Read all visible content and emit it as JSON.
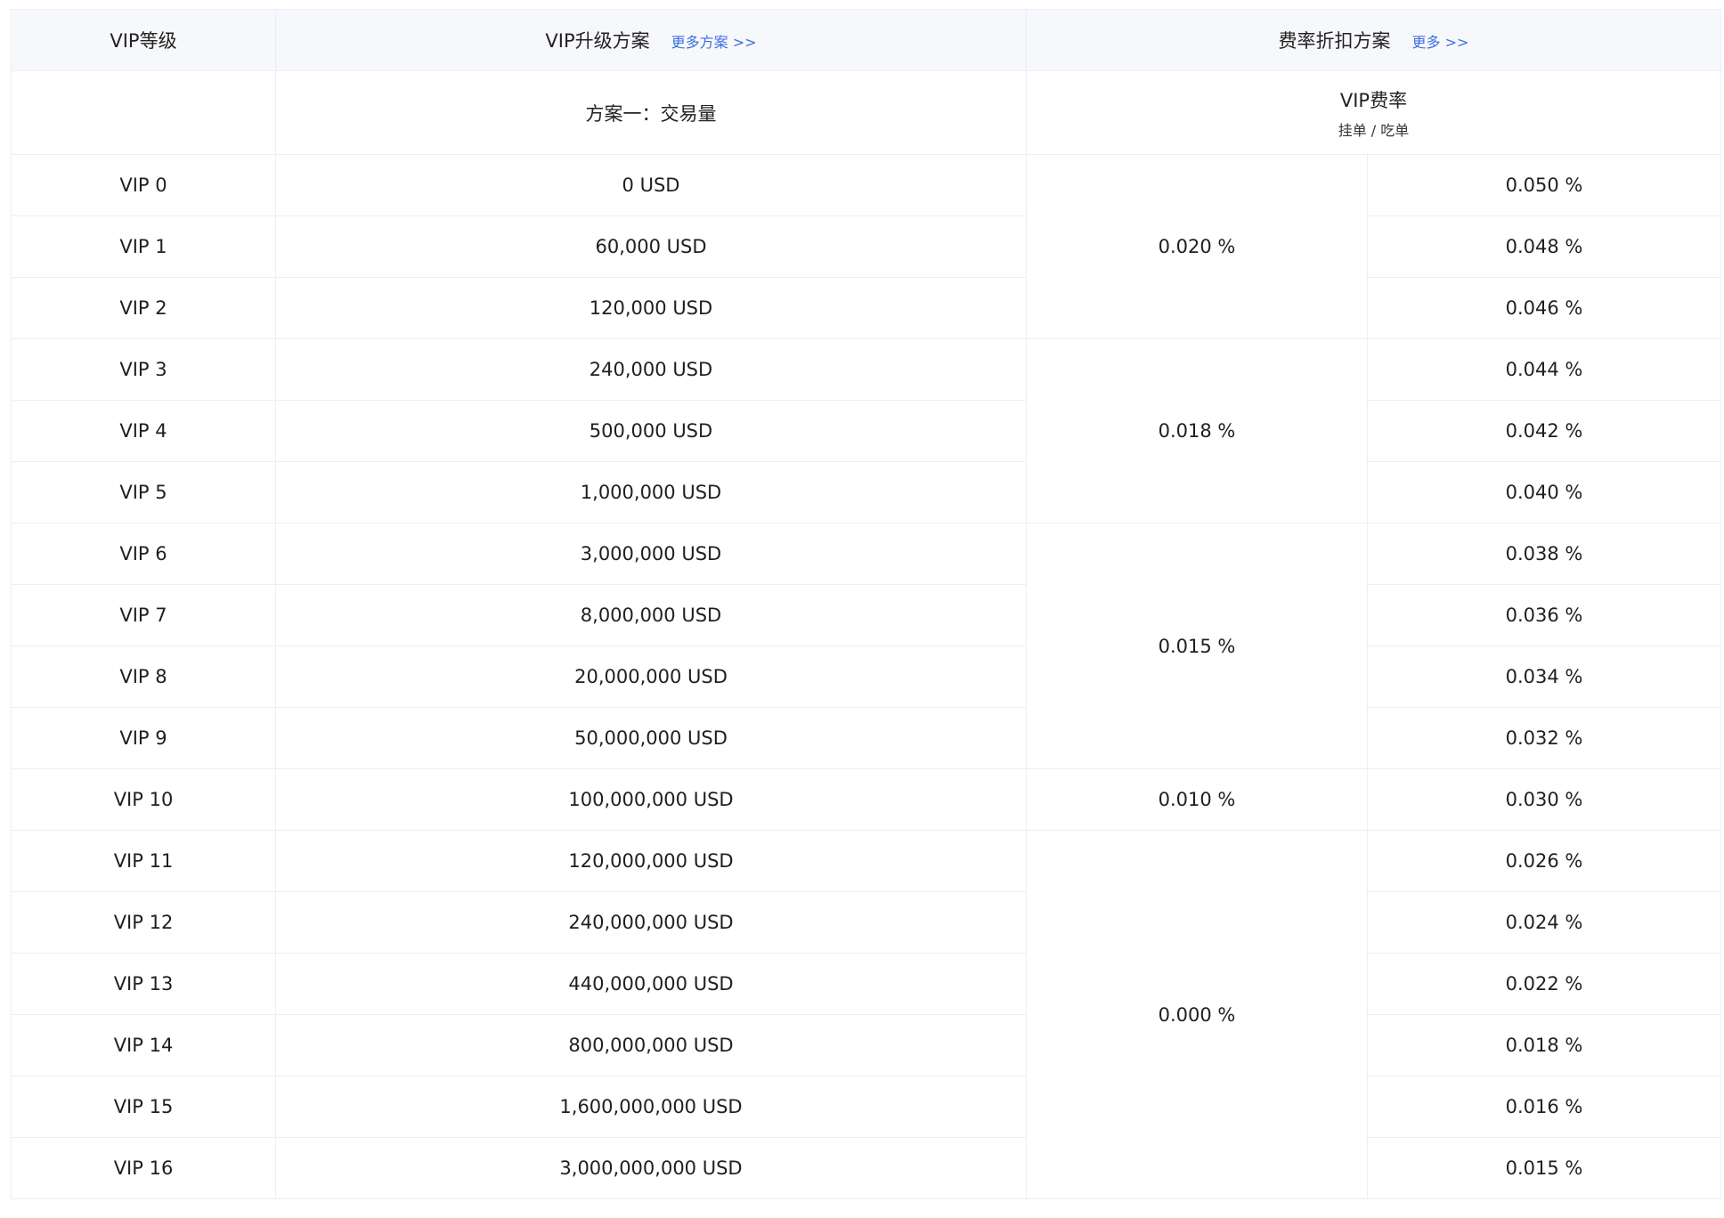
{
  "header": {
    "level_label": "VIP等级",
    "upgrade_label": "VIP升级方案",
    "upgrade_more": "更多方案 >>",
    "discount_label": "费率折扣方案",
    "discount_more": "更多 >>"
  },
  "subheader": {
    "plan_label": "方案一：交易量",
    "rate_label": "VIP费率",
    "rate_caption": "挂单 / 吃单"
  },
  "rows": [
    {
      "level": "VIP 0",
      "volume": "0 USD",
      "rate": "0.050 %"
    },
    {
      "level": "VIP 1",
      "volume": "60,000 USD",
      "rate": "0.048 %"
    },
    {
      "level": "VIP 2",
      "volume": "120,000 USD",
      "rate": "0.046 %"
    },
    {
      "level": "VIP 3",
      "volume": "240,000 USD",
      "rate": "0.044 %"
    },
    {
      "level": "VIP 4",
      "volume": "500,000 USD",
      "rate": "0.042 %"
    },
    {
      "level": "VIP 5",
      "volume": "1,000,000 USD",
      "rate": "0.040 %"
    },
    {
      "level": "VIP 6",
      "volume": "3,000,000 USD",
      "rate": "0.038 %"
    },
    {
      "level": "VIP 7",
      "volume": "8,000,000 USD",
      "rate": "0.036 %"
    },
    {
      "level": "VIP 8",
      "volume": "20,000,000 USD",
      "rate": "0.034 %"
    },
    {
      "level": "VIP 9",
      "volume": "50,000,000 USD",
      "rate": "0.032 %"
    },
    {
      "level": "VIP 10",
      "volume": "100,000,000 USD",
      "rate": "0.030 %"
    },
    {
      "level": "VIP 11",
      "volume": "120,000,000 USD",
      "rate": "0.026 %"
    },
    {
      "level": "VIP 12",
      "volume": "240,000,000 USD",
      "rate": "0.024 %"
    },
    {
      "level": "VIP 13",
      "volume": "440,000,000 USD",
      "rate": "0.022 %"
    },
    {
      "level": "VIP 14",
      "volume": "800,000,000 USD",
      "rate": "0.018 %"
    },
    {
      "level": "VIP 15",
      "volume": "1,600,000,000 USD",
      "rate": "0.016 %"
    },
    {
      "level": "VIP 16",
      "volume": "3,000,000,000 USD",
      "rate": "0.015 %"
    }
  ],
  "maker_groups": [
    {
      "value": "0.020 %",
      "span": 3
    },
    {
      "value": "0.018 %",
      "span": 3
    },
    {
      "value": "0.015 %",
      "span": 4
    },
    {
      "value": "0.010 %",
      "span": 1
    },
    {
      "value": "0.000 %",
      "span": 6
    }
  ]
}
